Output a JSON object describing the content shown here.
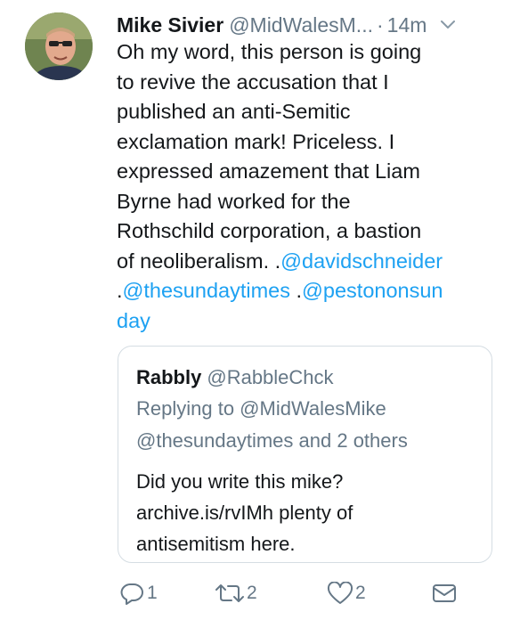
{
  "tweet": {
    "author_name": "Mike Sivier",
    "author_handle": "@MidWalesM...",
    "separator": "·",
    "time": "14m",
    "text_before": "Oh my word, this person is going\nto revive the accusation that I\npublished an anti-Semitic\nexclamation mark! Priceless. I\nexpressed amazement that Liam\nByrne had worked for the\nRothschild corporation, a bastion\nof neoliberalism. .",
    "mention1": "@davidschneider",
    "mid1": "\n.",
    "mention2": "@thesundaytimes",
    "mid2": " .",
    "mention3": "@pestononsun\nday"
  },
  "quote": {
    "author_name": "Rabbly",
    "author_handle": "@RabbleChck",
    "replying_to": "Replying to @MidWalesMike\n@thesundaytimes and 2 others",
    "text": "Did you write this mike?\narchive.is/rvIMh plenty of\nantisemitism here."
  },
  "actions": {
    "reply_count": "1",
    "retweet_count": "2",
    "like_count": "2"
  },
  "colors": {
    "link": "#1da1f2",
    "muted": "#657786",
    "border": "#d5dde3"
  }
}
